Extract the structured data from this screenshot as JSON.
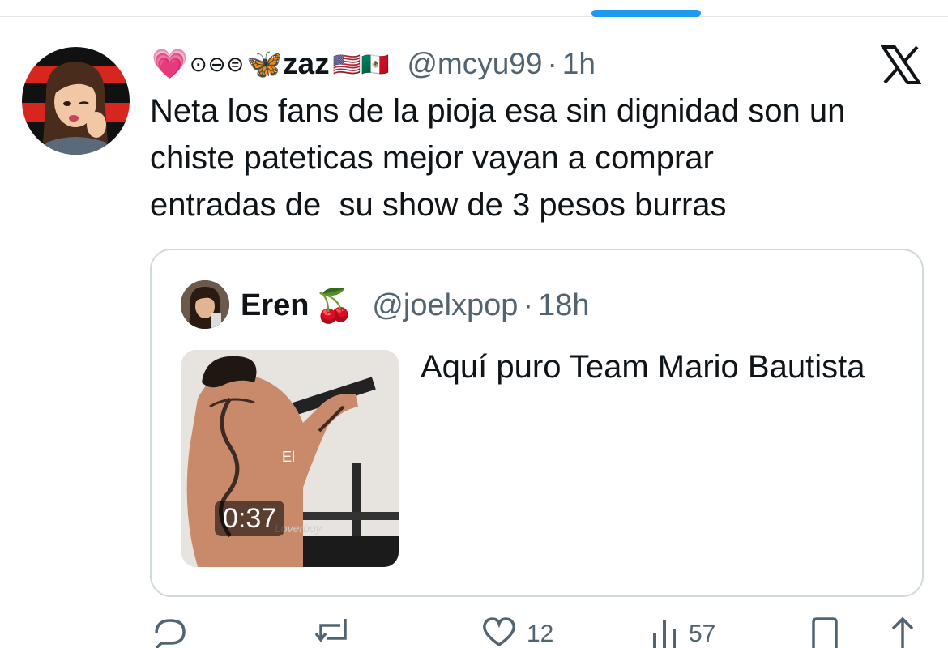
{
  "tweet": {
    "author": {
      "deco": "⊙⊖⊜",
      "heart_emoji": "💗",
      "butterfly_emoji": "🦋",
      "name": "zaz",
      "flags": "🇺🇸🇲🇽",
      "handle": "@mcyu99",
      "separator": "·",
      "time": "1h"
    },
    "platform_icon": "x-logo-icon",
    "text": "Neta los fans de la pioja esa sin dignidad son un\nchiste pateticas mejor vayan a comprar\nentradas de  su show de 3 pesos burras",
    "quote": {
      "name": "Eren",
      "emoji": "🍒",
      "handle": "@joelxpop",
      "separator": "·",
      "time": "18h",
      "media": {
        "duration": "0:37",
        "overlay_text": "El",
        "watermark": "Loverboy"
      },
      "text": "Aquí puro Team Mario Bautista"
    },
    "actions": {
      "reply_icon": "reply-icon",
      "retweet_icon": "retweet-icon",
      "like_icon": "heart-icon",
      "like_count": "12",
      "views_icon": "views-icon",
      "views_count": "57",
      "bookmark_icon": "bookmark-icon",
      "share_icon": "share-icon"
    }
  },
  "colors": {
    "accent": "#1d9bf0",
    "text": "#0f1419",
    "secondary": "#536471",
    "border": "#cfd9de"
  }
}
